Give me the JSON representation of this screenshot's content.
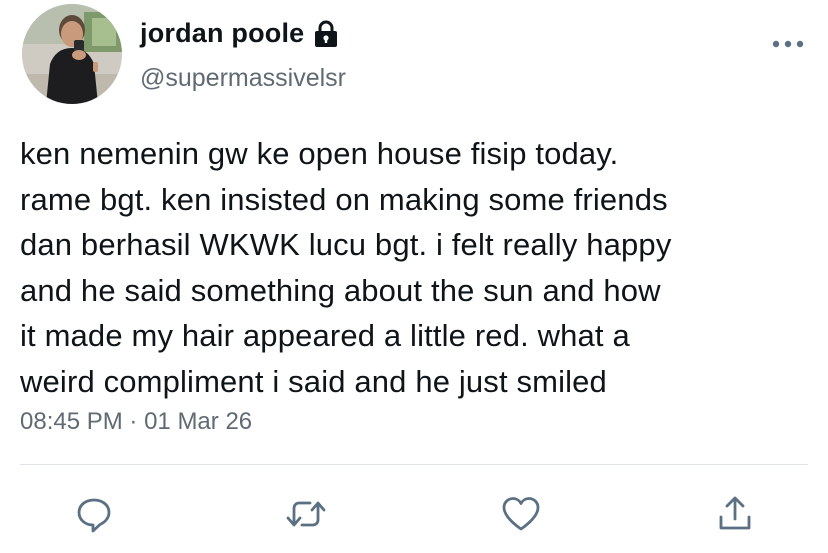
{
  "user": {
    "display_name": "jordan poole",
    "handle": "@supermassivelsr",
    "protected_icon": "lock-icon",
    "avatar_icon": "profile-photo"
  },
  "tweet": {
    "text_lines": [
      "ken nemenin gw ke open house fisip today.",
      "rame bgt. ken insisted on making some friends",
      "dan berhasil WKWK lucu bgt. i felt really happy",
      "and he said something about the sun and how",
      "it made my hair appeared a little red. what a",
      "weird compliment i said and he just smiled"
    ],
    "time": "08:45 PM",
    "separator": "·",
    "date": "01 Mar 26"
  },
  "actions": {
    "more": "more-options-icon",
    "reply": "reply-icon",
    "retweet": "retweet-icon",
    "like": "like-icon",
    "share": "share-icon"
  },
  "colors": {
    "text": "#0f1419",
    "secondary_text": "#606a73",
    "icon": "#5b7083",
    "divider": "#dfe3e6"
  }
}
